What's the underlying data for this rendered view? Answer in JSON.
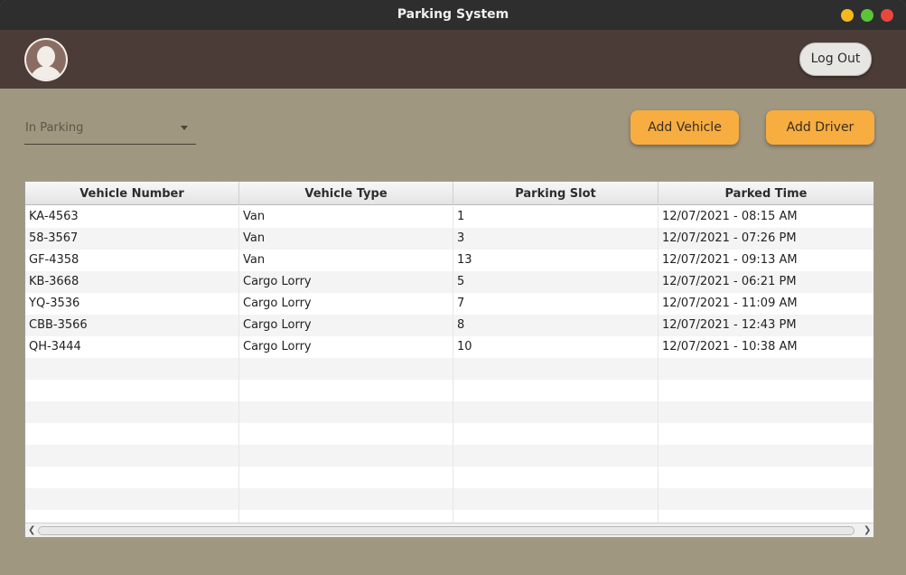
{
  "window": {
    "title": "Parking System"
  },
  "header": {
    "logout_label": "Log Out"
  },
  "controls": {
    "filter_selected": "In Parking",
    "add_vehicle_label": "Add Vehicle",
    "add_driver_label": "Add Driver"
  },
  "table": {
    "columns": [
      "Vehicle Number",
      "Vehicle Type",
      "Parking Slot",
      "Parked Time"
    ],
    "rows": [
      [
        "KA-4563",
        "Van",
        "1",
        "12/07/2021 - 08:15 AM"
      ],
      [
        "58-3567",
        "Van",
        "3",
        "12/07/2021 - 07:26 PM"
      ],
      [
        "GF-4358",
        "Van",
        "13",
        "12/07/2021 - 09:13 AM"
      ],
      [
        "KB-3668",
        "Cargo Lorry",
        "5",
        "12/07/2021 - 06:21 PM"
      ],
      [
        "YQ-3536",
        "Cargo Lorry",
        "7",
        "12/07/2021 - 11:09 AM"
      ],
      [
        "CBB-3566",
        "Cargo Lorry",
        "8",
        "12/07/2021 - 12:43 PM"
      ],
      [
        "QH-3444",
        "Cargo Lorry",
        "10",
        "12/07/2021 - 10:38 AM"
      ],
      [
        "",
        "",
        "",
        ""
      ],
      [
        "",
        "",
        "",
        ""
      ],
      [
        "",
        "",
        "",
        ""
      ],
      [
        "",
        "",
        "",
        ""
      ],
      [
        "",
        "",
        "",
        ""
      ],
      [
        "",
        "",
        "",
        ""
      ],
      [
        "",
        "",
        "",
        ""
      ],
      [
        "",
        "",
        "",
        ""
      ]
    ]
  },
  "colors": {
    "accent": "#f7ad40",
    "header_bg": "#4c3c37",
    "content_bg": "#a09780"
  }
}
